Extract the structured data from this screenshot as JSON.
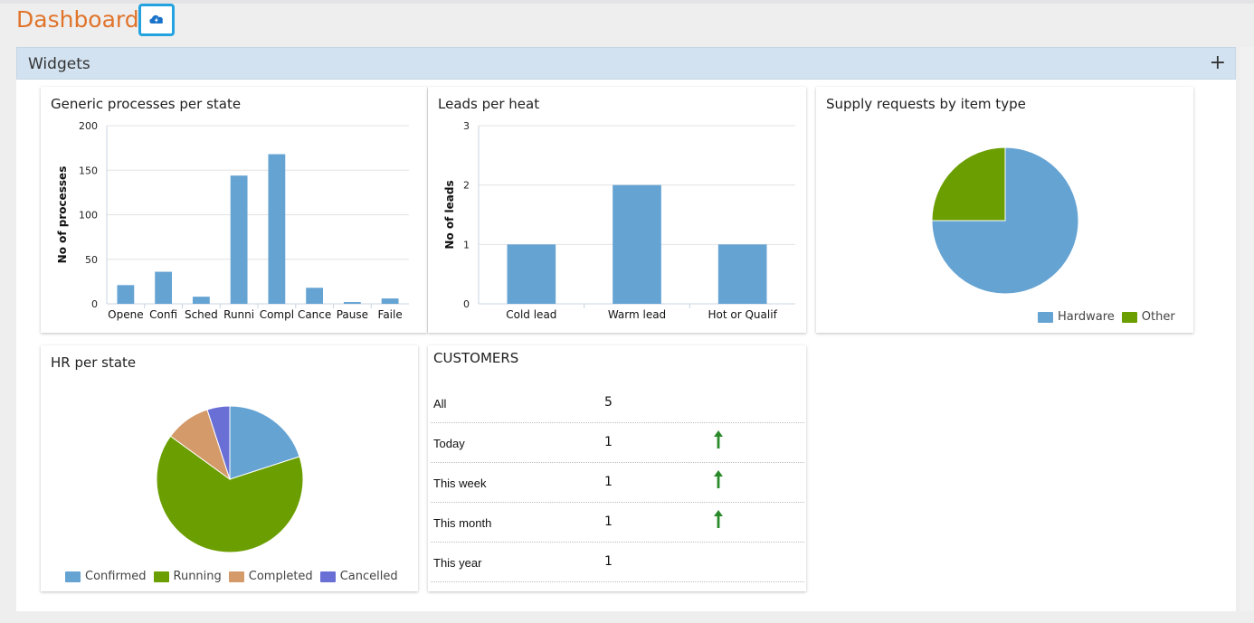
{
  "page": {
    "title": "Dashboard",
    "refresh_icon": "cloud-refresh-icon"
  },
  "widgets": {
    "title": "Widgets",
    "add_label": "+"
  },
  "generic_processes": {
    "title": "Generic processes per state",
    "chart_data": {
      "type": "bar",
      "categories": [
        "Opene",
        "Confi",
        "Sched",
        "Runni",
        "Compl",
        "Cance",
        "Pause",
        "Faile"
      ],
      "values": [
        21,
        36,
        8,
        144,
        168,
        18,
        2,
        6
      ],
      "ylabel": "No of processes",
      "ylim": [
        0,
        200
      ],
      "yticks": [
        0,
        50,
        100,
        150,
        200
      ],
      "color": "#65a3d3"
    }
  },
  "leads": {
    "title": "Leads per heat",
    "chart_data": {
      "type": "bar",
      "categories": [
        "Cold lead",
        "Warm lead",
        "Hot or Qualif"
      ],
      "values": [
        1,
        2,
        1
      ],
      "ylabel": "No of leads",
      "ylim": [
        0,
        3
      ],
      "yticks": [
        0,
        1,
        2,
        3
      ],
      "color": "#65a3d3"
    }
  },
  "supply": {
    "title": "Supply requests by item type",
    "chart_data": {
      "type": "pie",
      "slices": [
        {
          "label": "Hardware",
          "value": 75,
          "color": "#65a3d3"
        },
        {
          "label": "Other",
          "value": 25,
          "color": "#6b9e00"
        }
      ],
      "legend": "bottom-right"
    }
  },
  "hr": {
    "title": "HR per state",
    "chart_data": {
      "type": "pie",
      "slices": [
        {
          "label": "Confirmed",
          "value": 20,
          "color": "#65a3d3"
        },
        {
          "label": "Running",
          "value": 65,
          "color": "#6b9e00"
        },
        {
          "label": "Completed",
          "value": 10,
          "color": "#d49a6a"
        },
        {
          "label": "Cancelled",
          "value": 5,
          "color": "#6a6fd6"
        }
      ],
      "legend": "bottom"
    }
  },
  "customers": {
    "title": "CUSTOMERS",
    "rows": [
      {
        "label": "All",
        "count": "5",
        "trend": ""
      },
      {
        "label": "Today",
        "count": "1",
        "trend": "up"
      },
      {
        "label": "This week",
        "count": "1",
        "trend": "up"
      },
      {
        "label": "This month",
        "count": "1",
        "trend": "up"
      },
      {
        "label": "This year",
        "count": "1",
        "trend": ""
      }
    ],
    "trend_color": "#2a8a2a"
  }
}
